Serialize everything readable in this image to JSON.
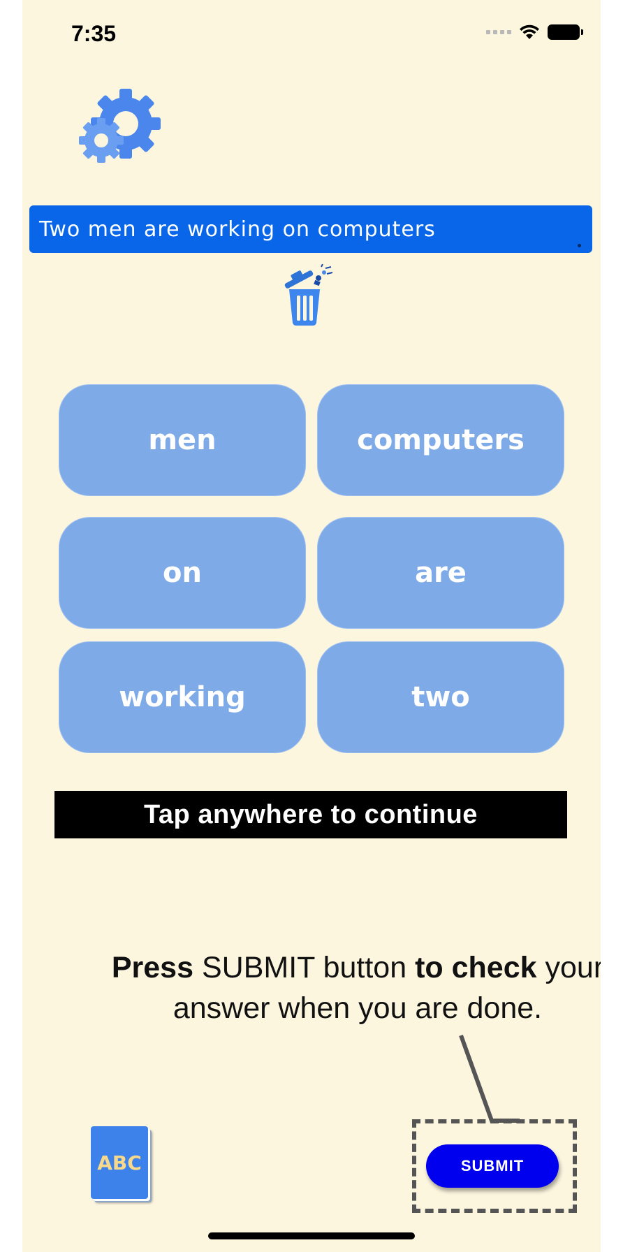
{
  "status_bar": {
    "time": "7:35"
  },
  "icons": {
    "settings": "gear-icon",
    "trash": "trash-icon",
    "dictionary": "abc-book-icon"
  },
  "sentence_bar": {
    "text": "Two men are working on computers"
  },
  "word_tiles": [
    {
      "label": "men"
    },
    {
      "label": "computers"
    },
    {
      "label": "on"
    },
    {
      "label": "are"
    },
    {
      "label": "working"
    },
    {
      "label": "two"
    }
  ],
  "overlay": {
    "continue_text": "Tap anywhere to continue"
  },
  "hint": {
    "press": "Press",
    "middle": " SUBMIT button ",
    "to_check": "to check",
    "rest": " your answer when you are done."
  },
  "dictionary": {
    "label": "ABC"
  },
  "submit": {
    "label": "SUBMIT"
  },
  "colors": {
    "background": "#fcf6df",
    "sentence_bar": "#0a66e8",
    "tile": "#7faae8",
    "submit": "#0000ee",
    "abc_text": "#f7d98c"
  }
}
